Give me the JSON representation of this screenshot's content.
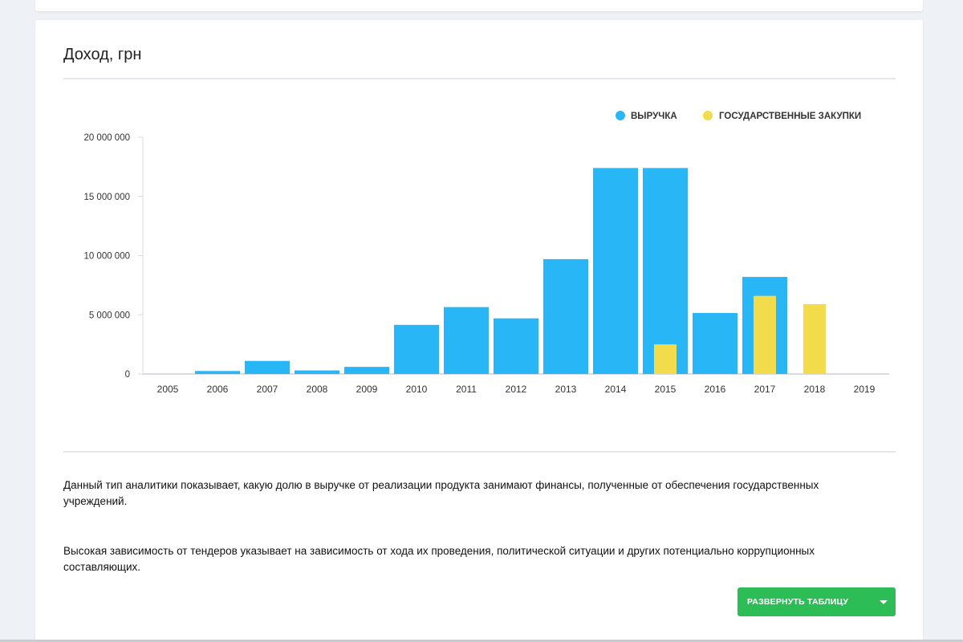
{
  "card": {
    "title": "Доход, грн"
  },
  "description": {
    "p1": "Данный тип аналитики показывает, какую долю в выручке от реализации продукта занимают финансы, полученные от обеспечения государственных учреждений.",
    "p2": "Высокая зависимость от тендеров указывает на зависимость от хода их проведения, политической ситуации и других потенциально коррупционных составляющих."
  },
  "button": {
    "expand_label": "РАЗВЕРНУТЬ ТАБЛИЦУ"
  },
  "colors": {
    "revenue": "#29b6f6",
    "procurement": "#f2dc4c",
    "button": "#2dbd57"
  },
  "chart_data": {
    "type": "bar",
    "categories": [
      "2005",
      "2006",
      "2007",
      "2008",
      "2009",
      "2010",
      "2011",
      "2012",
      "2013",
      "2014",
      "2015",
      "2016",
      "2017",
      "2018",
      "2019"
    ],
    "series": [
      {
        "name": "ВЫРУЧКА",
        "color": "#29b6f6",
        "values": [
          0,
          250000,
          1100000,
          300000,
          600000,
          4150000,
          5650000,
          4700000,
          9700000,
          17400000,
          17400000,
          5150000,
          8200000,
          0,
          0
        ]
      },
      {
        "name": "ГОСУДАРСТВЕННЫЕ ЗАКУПКИ",
        "color": "#f2dc4c",
        "values": [
          0,
          0,
          0,
          0,
          0,
          0,
          0,
          0,
          0,
          0,
          2500000,
          0,
          6600000,
          5900000,
          0
        ]
      }
    ],
    "yticks": [
      0,
      5000000,
      10000000,
      15000000,
      20000000
    ],
    "ytick_labels": [
      "0",
      "5 000 000",
      "10 000 000",
      "15 000 000",
      "20 000 000"
    ],
    "ylim": [
      0,
      20000000
    ],
    "xlabel": "",
    "ylabel": "",
    "legend_position": "top-right",
    "grid": false
  }
}
